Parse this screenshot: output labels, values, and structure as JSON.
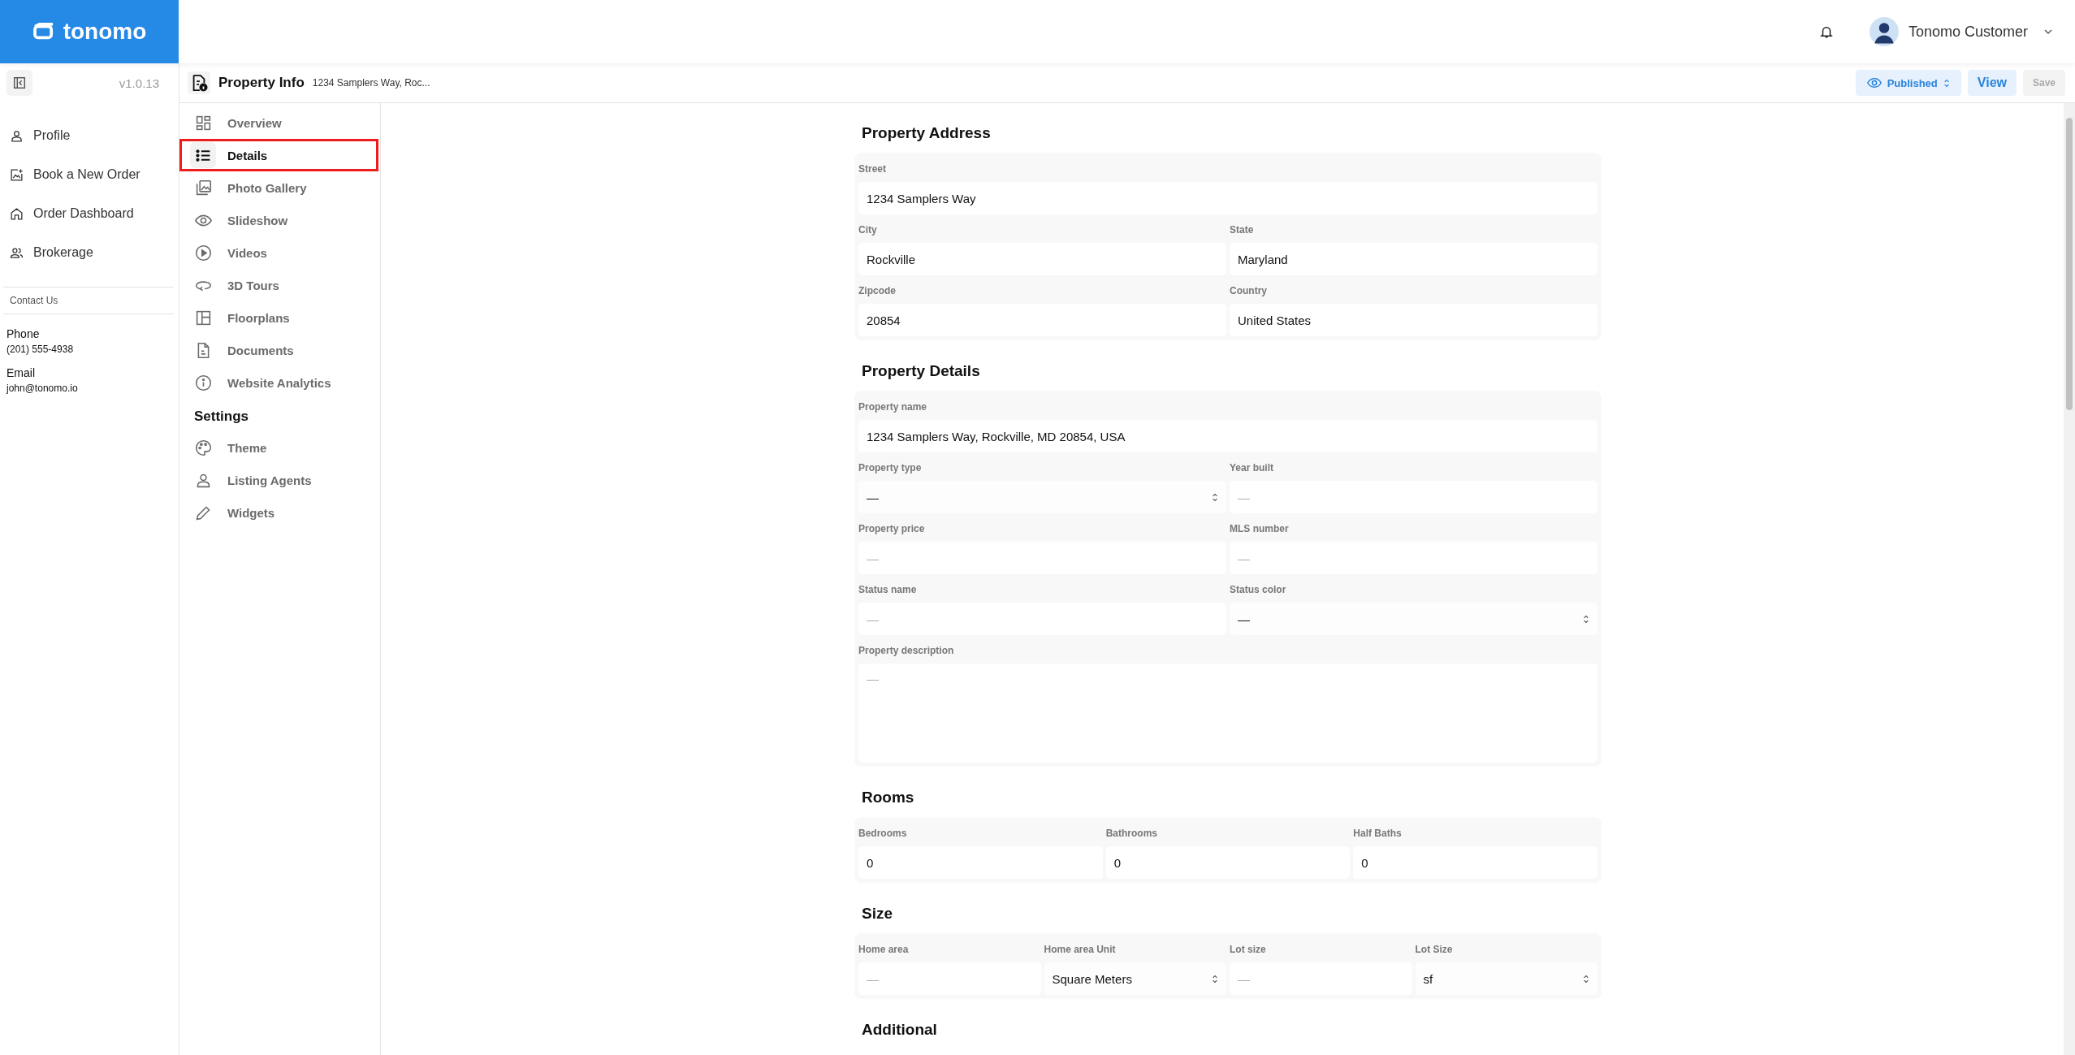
{
  "brand": {
    "name": "tonomo"
  },
  "header": {
    "user_name": "Tonomo Customer"
  },
  "sidebar": {
    "version": "v1.0.13",
    "items": [
      {
        "label": "Profile"
      },
      {
        "label": "Book a New Order"
      },
      {
        "label": "Order Dashboard"
      },
      {
        "label": "Brokerage"
      }
    ]
  },
  "contact": {
    "title": "Contact Us",
    "phone_label": "Phone",
    "phone": "(201) 555-4938",
    "email_label": "Email",
    "email": "john@tonomo.io"
  },
  "page_header": {
    "title": "Property Info",
    "subtitle": "1234 Samplers Way, Roc...",
    "status": "Published",
    "view_button": "View",
    "save_button": "Save",
    "save_disabled": true
  },
  "section_nav": {
    "items": [
      {
        "label": "Overview",
        "selected": false,
        "highlighted": false
      },
      {
        "label": "Details",
        "selected": true,
        "highlighted": true
      },
      {
        "label": "Photo Gallery",
        "selected": false,
        "highlighted": false
      },
      {
        "label": "Slideshow",
        "selected": false,
        "highlighted": false
      },
      {
        "label": "Videos",
        "selected": false,
        "highlighted": false
      },
      {
        "label": "3D Tours",
        "selected": false,
        "highlighted": false
      },
      {
        "label": "Floorplans",
        "selected": false,
        "highlighted": false
      },
      {
        "label": "Documents",
        "selected": false,
        "highlighted": false
      },
      {
        "label": "Website Analytics",
        "selected": false,
        "highlighted": false
      }
    ],
    "settings_title": "Settings",
    "settings_items": [
      {
        "label": "Theme",
        "selected": false
      },
      {
        "label": "Listing Agents",
        "selected": false
      },
      {
        "label": "Widgets",
        "selected": false
      }
    ]
  },
  "sections": [
    {
      "title": "Property Address",
      "rows": [
        [
          {
            "label": "Street",
            "kind": "input",
            "value": "1234 Samplers Way"
          }
        ],
        [
          {
            "label": "City",
            "kind": "input",
            "value": "Rockville"
          },
          {
            "label": "State",
            "kind": "input",
            "value": "Maryland"
          }
        ],
        [
          {
            "label": "Zipcode",
            "kind": "input",
            "value": "20854"
          },
          {
            "label": "Country",
            "kind": "input",
            "value": "United States"
          }
        ]
      ]
    },
    {
      "title": "Property Details",
      "rows": [
        [
          {
            "label": "Property name",
            "kind": "input",
            "value": "1234 Samplers Way, Rockville, MD 20854, USA"
          }
        ],
        [
          {
            "label": "Property type",
            "kind": "select",
            "value": "—"
          },
          {
            "label": "Year built",
            "kind": "input",
            "placeholder": "—"
          }
        ],
        [
          {
            "label": "Property price",
            "kind": "input",
            "placeholder": "—"
          },
          {
            "label": "MLS number",
            "kind": "input",
            "placeholder": "—"
          }
        ],
        [
          {
            "label": "Status name",
            "kind": "input",
            "placeholder": "—"
          },
          {
            "label": "Status color",
            "kind": "select",
            "value": "—"
          }
        ],
        [
          {
            "label": "Property description",
            "kind": "textarea",
            "placeholder": "—"
          }
        ]
      ]
    },
    {
      "title": "Rooms",
      "rows": [
        [
          {
            "label": "Bedrooms",
            "kind": "input",
            "value": "0"
          },
          {
            "label": "Bathrooms",
            "kind": "input",
            "value": "0"
          },
          {
            "label": "Half Baths",
            "kind": "input",
            "value": "0"
          }
        ]
      ]
    },
    {
      "title": "Size",
      "rows": [
        [
          {
            "label": "Home area",
            "kind": "input",
            "placeholder": "—"
          },
          {
            "label": "Home area Unit",
            "kind": "select",
            "value": "Square Meters"
          },
          {
            "label": "Lot size",
            "kind": "input",
            "placeholder": "—"
          },
          {
            "label": "Lot Size",
            "kind": "select",
            "value": "sf"
          }
        ]
      ]
    },
    {
      "title": "Additional"
    }
  ]
}
